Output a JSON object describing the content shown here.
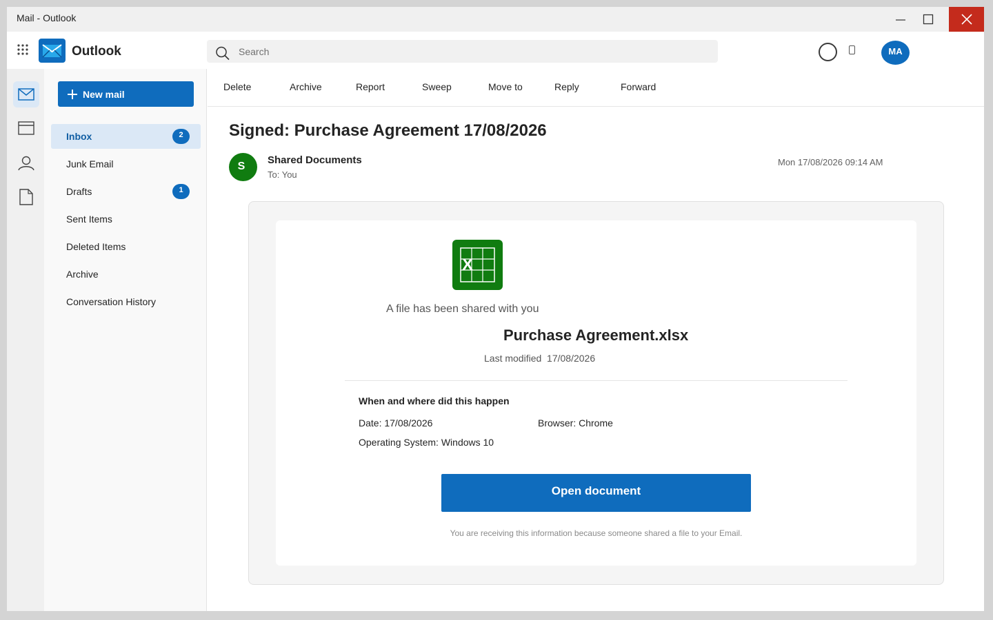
{
  "window": {
    "title": "Mail - Outlook"
  },
  "header": {
    "brand": "Outlook",
    "search_placeholder": "Search",
    "avatar_initials": "MA"
  },
  "sidebar": {
    "new_mail_label": "New mail",
    "folders": [
      {
        "label": "Inbox",
        "badge": "2",
        "active": true
      },
      {
        "label": "Junk Email"
      },
      {
        "label": "Drafts",
        "badge": "1"
      },
      {
        "label": "Sent Items"
      },
      {
        "label": "Deleted Items"
      },
      {
        "label": "Archive"
      },
      {
        "label": "Conversation History"
      }
    ]
  },
  "toolbar": {
    "actions": [
      "Delete",
      "Archive",
      "Report",
      "Sweep",
      "Move to",
      "Reply",
      "Forward"
    ]
  },
  "message": {
    "subject": "Signed: Purchase Agreement 17/08/2026",
    "sender_initial": "S",
    "sender_name": "Shared Documents",
    "to_line": "To: You",
    "date": "Mon 17/08/2026 09:14 AM",
    "body": {
      "file_icon_letter": "X",
      "shared_line": "A file has been shared with you",
      "file_name": "Purchase Agreement.xlsx",
      "last_modified": "Last modified  17/08/2026",
      "details_heading": "When and where did this happen",
      "date_line": "Date: 17/08/2026",
      "browser_line": "Browser: Chrome",
      "os_line": "Operating System: Windows 10",
      "button_label": "Open document",
      "footnote": "You are receiving this information because someone shared a file to your Email."
    }
  },
  "colors": {
    "accent": "#0f6cbd",
    "close_red": "#c42b1c",
    "excel_green": "#107c10",
    "selected_folder_bg": "#dbe8f6"
  }
}
